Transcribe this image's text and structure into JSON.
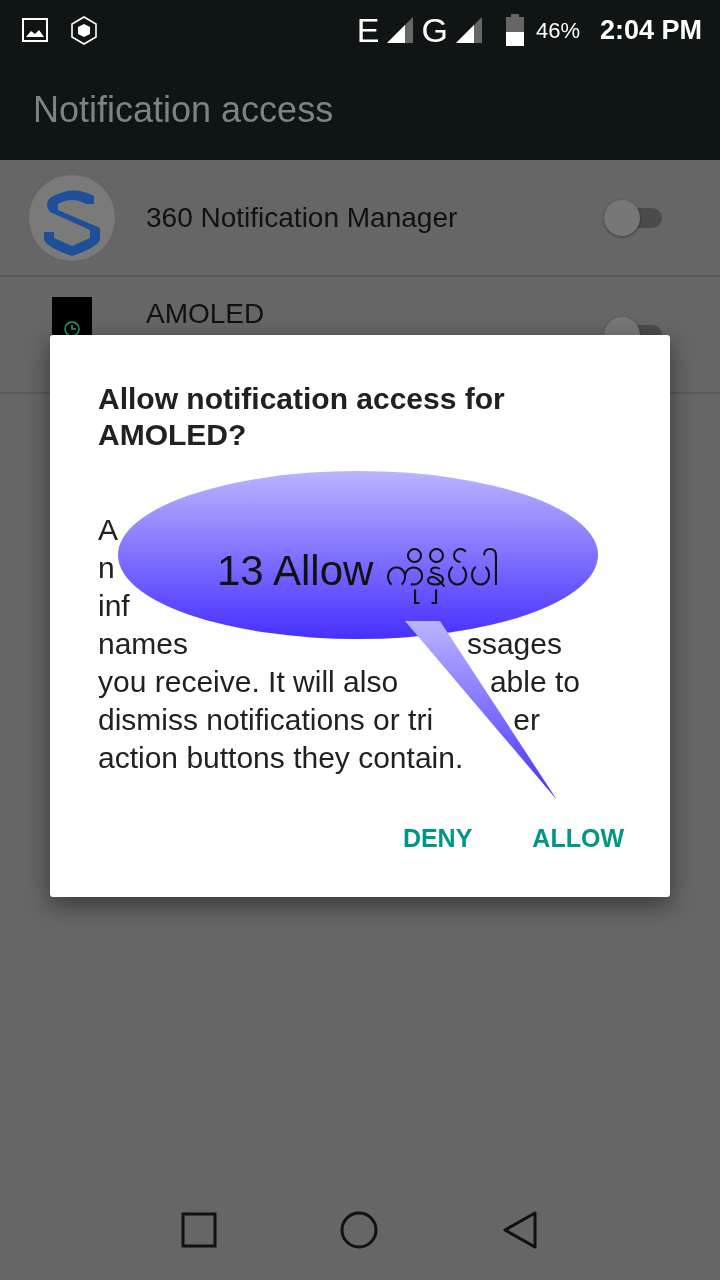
{
  "status_bar": {
    "network_1": "E",
    "network_2": "G",
    "battery": "46%",
    "time": "2:04 PM"
  },
  "app_bar": {
    "title": "Notification access"
  },
  "apps": [
    {
      "name": "360 Notification Manager",
      "on": false
    },
    {
      "name": "AMOLED",
      "on": false
    }
  ],
  "dialog": {
    "title": "Allow notification access for AMOLED?",
    "body_lines": [
      {
        "left": "A"
      },
      {
        "left": "n"
      },
      {
        "left": "inf"
      },
      {
        "left": "names",
        "right": "ssages"
      },
      {
        "left": "you receive. It will also",
        "right": "able to"
      },
      {
        "left": "dismiss notifications or tri",
        "right": "er"
      },
      {
        "left": "action buttons they contain."
      }
    ],
    "buttons": [
      {
        "label": "DENY"
      },
      {
        "label": "ALLOW"
      }
    ]
  },
  "callout": {
    "text": "13  Allow ကိုနှိပ်ပါ"
  }
}
